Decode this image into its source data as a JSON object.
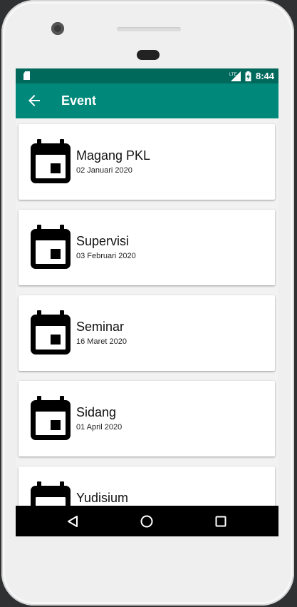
{
  "status_bar": {
    "network": "LTE",
    "time": "8:44"
  },
  "app_bar": {
    "title": "Event",
    "back_icon": "arrow-back-icon"
  },
  "events": [
    {
      "title": "Magang PKL",
      "date": "02 Januari 2020",
      "icon": "calendar-icon"
    },
    {
      "title": "Supervisi",
      "date": "03 Februari 2020",
      "icon": "calendar-icon"
    },
    {
      "title": "Seminar",
      "date": "16 Maret 2020",
      "icon": "calendar-icon"
    },
    {
      "title": "Sidang",
      "date": "01 April 2020",
      "icon": "calendar-icon"
    },
    {
      "title": "Yudisium",
      "date": "",
      "icon": "calendar-icon"
    }
  ],
  "nav_bar": {
    "back": "triangle-back-icon",
    "home": "circle-home-icon",
    "recents": "square-recents-icon"
  },
  "colors": {
    "status_bar": "#00695c",
    "app_bar": "#00897b",
    "nav_bar": "#000000",
    "background": "#f2f2f2"
  }
}
